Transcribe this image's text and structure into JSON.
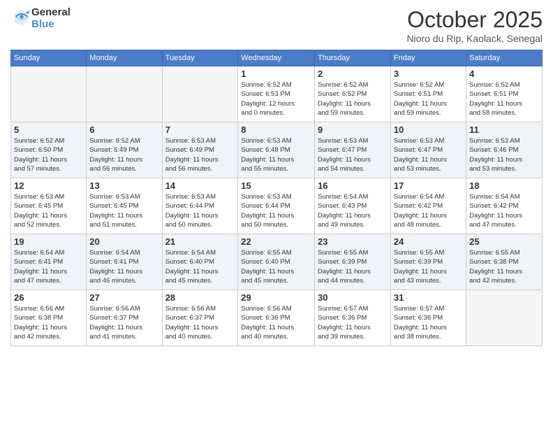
{
  "logo": {
    "line1": "General",
    "line2": "Blue"
  },
  "header": {
    "month": "October 2025",
    "location": "Nioro du Rip, Kaolack, Senegal"
  },
  "weekdays": [
    "Sunday",
    "Monday",
    "Tuesday",
    "Wednesday",
    "Thursday",
    "Friday",
    "Saturday"
  ],
  "weeks": [
    [
      {
        "day": "",
        "info": ""
      },
      {
        "day": "",
        "info": ""
      },
      {
        "day": "",
        "info": ""
      },
      {
        "day": "1",
        "info": "Sunrise: 6:52 AM\nSunset: 6:53 PM\nDaylight: 12 hours\nand 0 minutes."
      },
      {
        "day": "2",
        "info": "Sunrise: 6:52 AM\nSunset: 6:52 PM\nDaylight: 11 hours\nand 59 minutes."
      },
      {
        "day": "3",
        "info": "Sunrise: 6:52 AM\nSunset: 6:51 PM\nDaylight: 11 hours\nand 59 minutes."
      },
      {
        "day": "4",
        "info": "Sunrise: 6:52 AM\nSunset: 6:51 PM\nDaylight: 11 hours\nand 58 minutes."
      }
    ],
    [
      {
        "day": "5",
        "info": "Sunrise: 6:52 AM\nSunset: 6:50 PM\nDaylight: 11 hours\nand 57 minutes."
      },
      {
        "day": "6",
        "info": "Sunrise: 6:52 AM\nSunset: 6:49 PM\nDaylight: 11 hours\nand 56 minutes."
      },
      {
        "day": "7",
        "info": "Sunrise: 6:53 AM\nSunset: 6:49 PM\nDaylight: 11 hours\nand 56 minutes."
      },
      {
        "day": "8",
        "info": "Sunrise: 6:53 AM\nSunset: 6:48 PM\nDaylight: 11 hours\nand 55 minutes."
      },
      {
        "day": "9",
        "info": "Sunrise: 6:53 AM\nSunset: 6:47 PM\nDaylight: 11 hours\nand 54 minutes."
      },
      {
        "day": "10",
        "info": "Sunrise: 6:53 AM\nSunset: 6:47 PM\nDaylight: 11 hours\nand 53 minutes."
      },
      {
        "day": "11",
        "info": "Sunrise: 6:53 AM\nSunset: 6:46 PM\nDaylight: 11 hours\nand 53 minutes."
      }
    ],
    [
      {
        "day": "12",
        "info": "Sunrise: 6:53 AM\nSunset: 6:45 PM\nDaylight: 11 hours\nand 52 minutes."
      },
      {
        "day": "13",
        "info": "Sunrise: 6:53 AM\nSunset: 6:45 PM\nDaylight: 11 hours\nand 51 minutes."
      },
      {
        "day": "14",
        "info": "Sunrise: 6:53 AM\nSunset: 6:44 PM\nDaylight: 11 hours\nand 50 minutes."
      },
      {
        "day": "15",
        "info": "Sunrise: 6:53 AM\nSunset: 6:44 PM\nDaylight: 11 hours\nand 50 minutes."
      },
      {
        "day": "16",
        "info": "Sunrise: 6:54 AM\nSunset: 6:43 PM\nDaylight: 11 hours\nand 49 minutes."
      },
      {
        "day": "17",
        "info": "Sunrise: 6:54 AM\nSunset: 6:42 PM\nDaylight: 11 hours\nand 48 minutes."
      },
      {
        "day": "18",
        "info": "Sunrise: 6:54 AM\nSunset: 6:42 PM\nDaylight: 11 hours\nand 47 minutes."
      }
    ],
    [
      {
        "day": "19",
        "info": "Sunrise: 6:54 AM\nSunset: 6:41 PM\nDaylight: 11 hours\nand 47 minutes."
      },
      {
        "day": "20",
        "info": "Sunrise: 6:54 AM\nSunset: 6:41 PM\nDaylight: 11 hours\nand 46 minutes."
      },
      {
        "day": "21",
        "info": "Sunrise: 6:54 AM\nSunset: 6:40 PM\nDaylight: 11 hours\nand 45 minutes."
      },
      {
        "day": "22",
        "info": "Sunrise: 6:55 AM\nSunset: 6:40 PM\nDaylight: 11 hours\nand 45 minutes."
      },
      {
        "day": "23",
        "info": "Sunrise: 6:55 AM\nSunset: 6:39 PM\nDaylight: 11 hours\nand 44 minutes."
      },
      {
        "day": "24",
        "info": "Sunrise: 6:55 AM\nSunset: 6:39 PM\nDaylight: 11 hours\nand 43 minutes."
      },
      {
        "day": "25",
        "info": "Sunrise: 6:55 AM\nSunset: 6:38 PM\nDaylight: 11 hours\nand 42 minutes."
      }
    ],
    [
      {
        "day": "26",
        "info": "Sunrise: 6:56 AM\nSunset: 6:38 PM\nDaylight: 11 hours\nand 42 minutes."
      },
      {
        "day": "27",
        "info": "Sunrise: 6:56 AM\nSunset: 6:37 PM\nDaylight: 11 hours\nand 41 minutes."
      },
      {
        "day": "28",
        "info": "Sunrise: 6:56 AM\nSunset: 6:37 PM\nDaylight: 11 hours\nand 40 minutes."
      },
      {
        "day": "29",
        "info": "Sunrise: 6:56 AM\nSunset: 6:36 PM\nDaylight: 11 hours\nand 40 minutes."
      },
      {
        "day": "30",
        "info": "Sunrise: 6:57 AM\nSunset: 6:36 PM\nDaylight: 11 hours\nand 39 minutes."
      },
      {
        "day": "31",
        "info": "Sunrise: 6:57 AM\nSunset: 6:36 PM\nDaylight: 11 hours\nand 38 minutes."
      },
      {
        "day": "",
        "info": ""
      }
    ]
  ]
}
